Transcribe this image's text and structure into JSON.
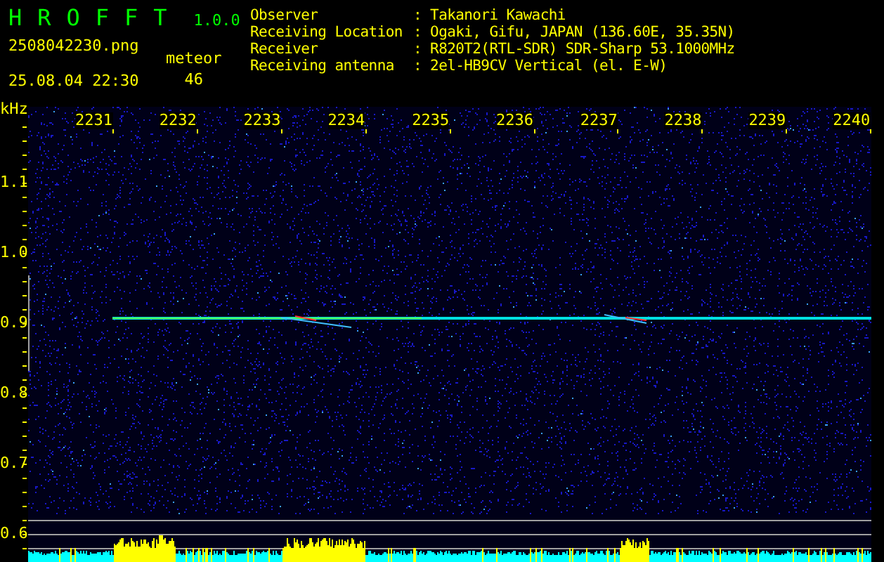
{
  "header": {
    "app_name": "HROFFT",
    "version": "1.0.0",
    "filename": "2508042230.png",
    "timestamp": "25.08.04 22:30",
    "meteor_label": "meteor",
    "meteor_count": "46"
  },
  "info": [
    {
      "label": "Observer",
      "value": ": Takanori Kawachi"
    },
    {
      "label": "Receiving Location",
      "value": ": Ogaki, Gifu, JAPAN (136.60E, 35.35N)"
    },
    {
      "label": "Receiver",
      "value": ": R820T2(RTL-SDR) SDR-Sharp 53.1000MHz"
    },
    {
      "label": "Receiving antenna",
      "value": ": 2el-HB9CV Vertical (el. E-W)"
    }
  ],
  "spectrogram": {
    "unit": "kHz",
    "x_labels": [
      "2231",
      "2232",
      "2233",
      "2234",
      "2235",
      "2236",
      "2237",
      "2238",
      "2239",
      "2240"
    ],
    "y_labels": [
      "1.1",
      "1.0",
      "0.9",
      "0.8",
      "0.7",
      "0.6"
    ]
  }
}
